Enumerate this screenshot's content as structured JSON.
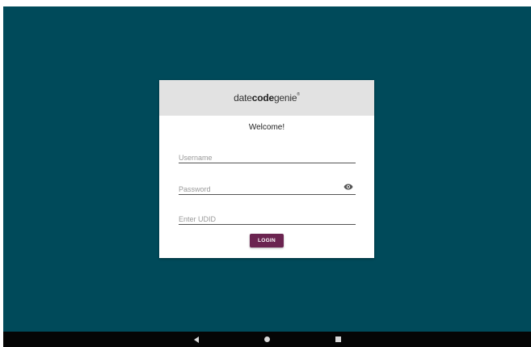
{
  "app": {
    "logo": {
      "part1": "date",
      "part2": "code",
      "part3": "genie",
      "mark": "®"
    },
    "welcome": "Welcome!"
  },
  "form": {
    "username": {
      "placeholder": "Username",
      "value": ""
    },
    "password": {
      "placeholder": "Password",
      "value": "",
      "toggle_icon": "eye-icon"
    },
    "udid": {
      "placeholder": "Enter UDID",
      "value": ""
    },
    "login_label": "LOGIN"
  },
  "navbar": {
    "back_icon": "back-triangle-icon",
    "home_icon": "home-circle-icon",
    "recents_icon": "recents-square-icon"
  },
  "colors": {
    "background": "#004a5a",
    "header": "#e2e2e2",
    "login_button": "#6b2450",
    "navbar": "#050505"
  }
}
